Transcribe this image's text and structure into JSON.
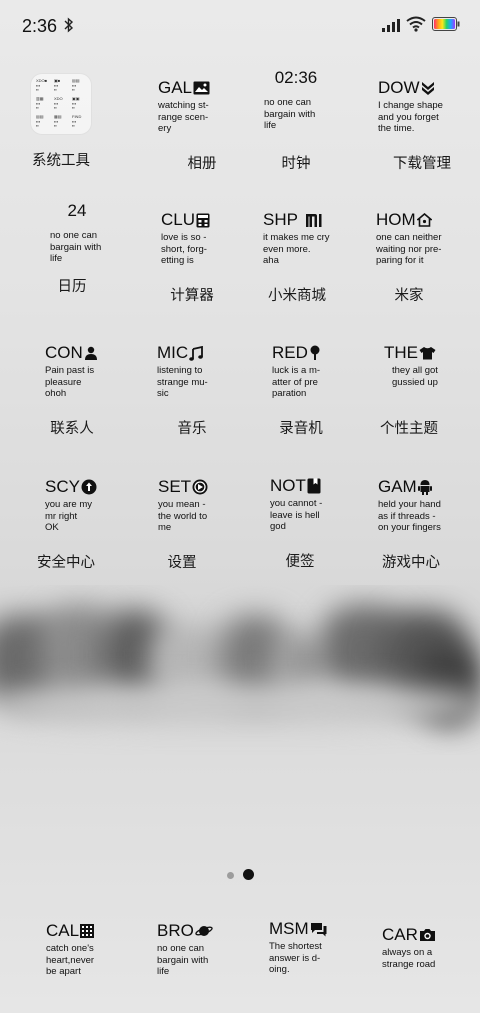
{
  "status_bar": {
    "time": "2:36",
    "icons": [
      "bluetooth-icon",
      "signal-icon",
      "wifi-icon",
      "battery-icon"
    ],
    "battery_colors": [
      "#ff2f6d",
      "#ff9f1a",
      "#ffe81a",
      "#22d36a",
      "#22a3ff",
      "#9b3cff"
    ]
  },
  "folder": {
    "label": "系统工具",
    "mini_tiles": [
      "XDO",
      "",
      "",
      "",
      "FIND",
      "",
      "",
      "",
      ""
    ]
  },
  "apps": [
    {
      "head": "GAL",
      "icon": "image-icon",
      "body": "watching st-\nrange scen-\nery",
      "label": "相册"
    },
    {
      "head": "02:36",
      "icon": "",
      "body": "no one can\nbargain with\nlife",
      "label": "时钟"
    },
    {
      "head": "DOW",
      "icon": "download-chevrons-icon",
      "body": "I change shape\nand you forget\nthe time.",
      "label": "下载管理"
    },
    {
      "head": "24",
      "icon": "",
      "body": "no one can\nbargain with\nlife",
      "label": "日历"
    },
    {
      "head": "CLU",
      "icon": "calculator-icon",
      "body": "love is so -\nshort, forg-\netting is",
      "label": "计算器"
    },
    {
      "head": "SHP",
      "icon": "mi-logo-icon",
      "body": "it makes me cry\neven more.\naha",
      "label": "小米商城"
    },
    {
      "head": "HOM",
      "icon": "home-icon",
      "body": "one can neither\nwaiting nor pre-\nparing for it",
      "label": "米家"
    },
    {
      "head": "CON",
      "icon": "person-icon",
      "body": "Pain past is\npleasure\nohoh",
      "label": "联系人"
    },
    {
      "head": "MIC",
      "icon": "music-note-icon",
      "body": "listening to\nstrange mu-\nsic",
      "label": "音乐"
    },
    {
      "head": "RED",
      "icon": "microphone-icon",
      "body": "luck is a m-\natter of pre\nparation",
      "label": "录音机"
    },
    {
      "head": "THE",
      "icon": "tshirt-icon",
      "body": "they all got\ngussied up",
      "label": "个性主题"
    },
    {
      "head": "SCY",
      "icon": "shield-up-icon",
      "body": "you are my\nmr right\nOK",
      "label": "安全中心"
    },
    {
      "head": "SET",
      "icon": "settings-play-icon",
      "body": "you mean -\nthe world to\nme",
      "label": "设置"
    },
    {
      "head": "NOT",
      "icon": "note-icon",
      "body": "you cannot -\nleave is hell\ngod",
      "label": "便签"
    },
    {
      "head": "GAM",
      "icon": "android-icon",
      "body": "held your hand\nas if threads -\non your fingers",
      "label": "游戏中心"
    }
  ],
  "dock": [
    {
      "head": "CAL",
      "icon": "keypad-icon",
      "body": "catch one's\nheart,never\nbe apart"
    },
    {
      "head": "BRO",
      "icon": "planet-icon",
      "body": "no one can\nbargain with\nlife"
    },
    {
      "head": "MSM",
      "icon": "chat-bubbles-icon",
      "body": "The shortest\nanswer is d-\noing."
    },
    {
      "head": "CAR",
      "icon": "camera-icon",
      "body": "always on a\nstrange road"
    }
  ],
  "pager": {
    "pages": 2,
    "current": 2
  }
}
